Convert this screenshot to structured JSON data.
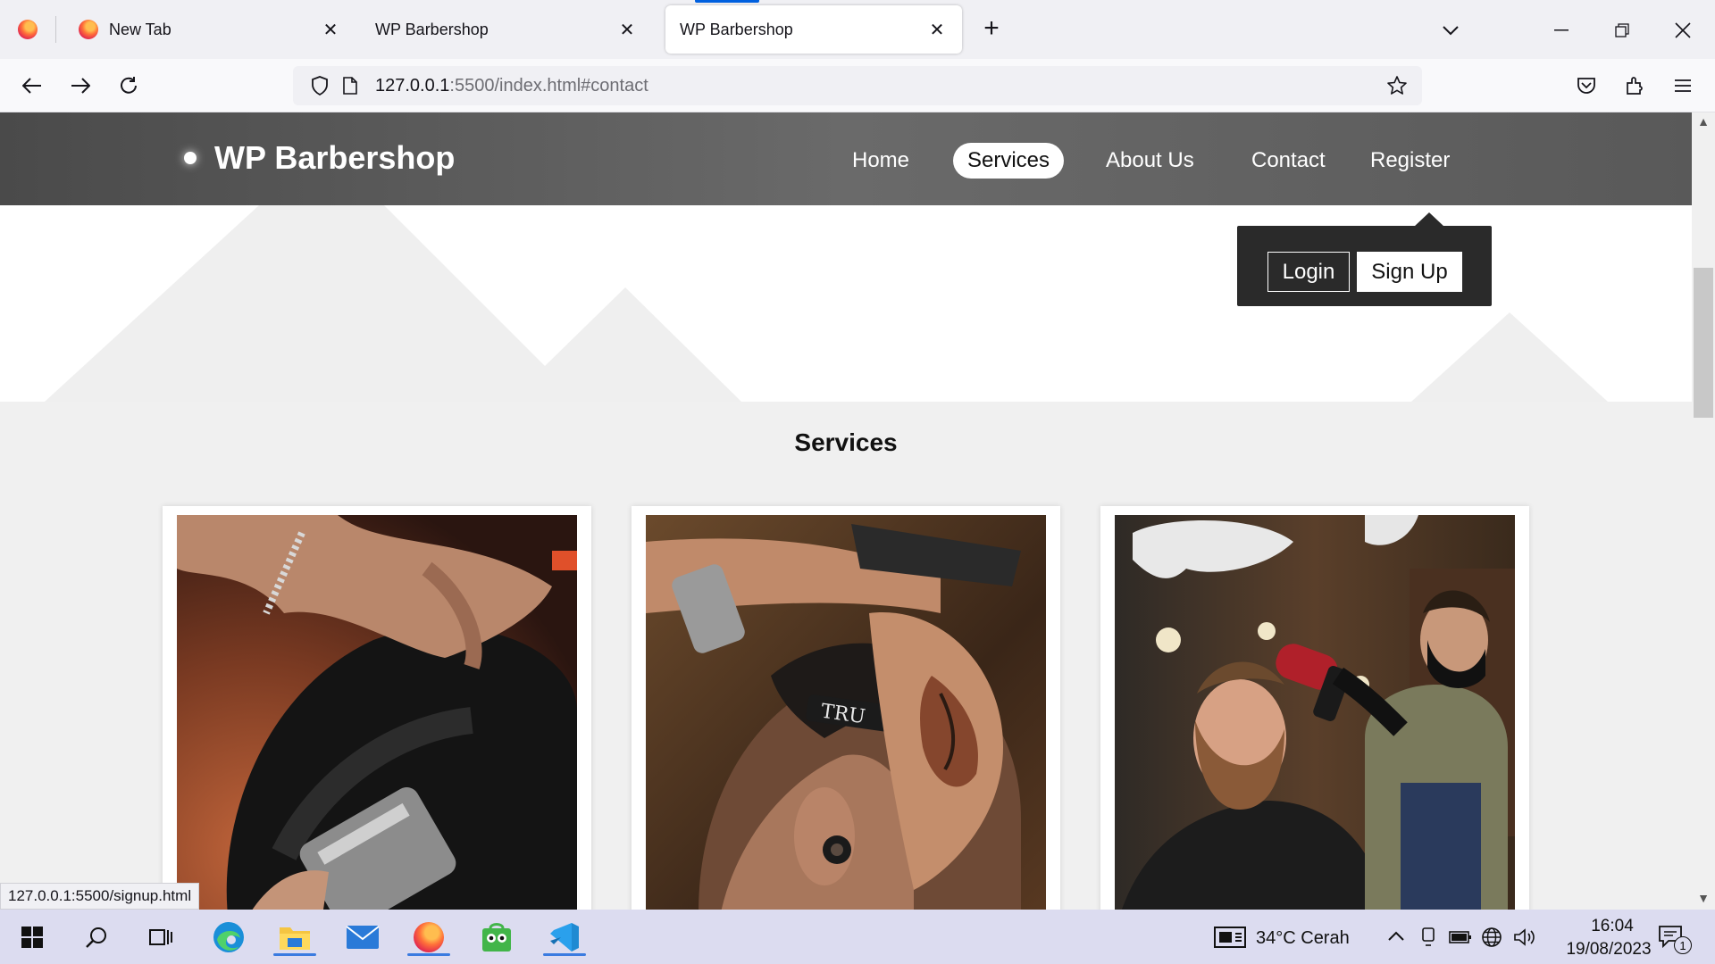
{
  "browser": {
    "tabs": [
      {
        "title": "New Tab",
        "icon": "firefox-icon"
      },
      {
        "title": "WP Barbershop",
        "icon": "none"
      },
      {
        "title": "WP Barbershop",
        "icon": "none",
        "active": true
      }
    ],
    "url_host": "127.0.0.1",
    "url_rest": ":5500/index.html#contact",
    "status_link": "127.0.0.1:5500/signup.html"
  },
  "site": {
    "brand": "WP Barbershop",
    "menu": {
      "home": "Home",
      "services": "Services",
      "about": "About Us",
      "contact": "Contact",
      "register": "Register"
    },
    "dropdown": {
      "login": "Login",
      "signup": "Sign Up"
    },
    "section_title": "Services"
  },
  "taskbar": {
    "weather": "34°C  Cerah",
    "time": "16:04",
    "date": "19/08/2023",
    "notification_count": "1"
  },
  "colors": {
    "header_bg": "#595959",
    "active_tab_indicator": "#0060df",
    "dropdown_bg": "#2a2a2a"
  }
}
